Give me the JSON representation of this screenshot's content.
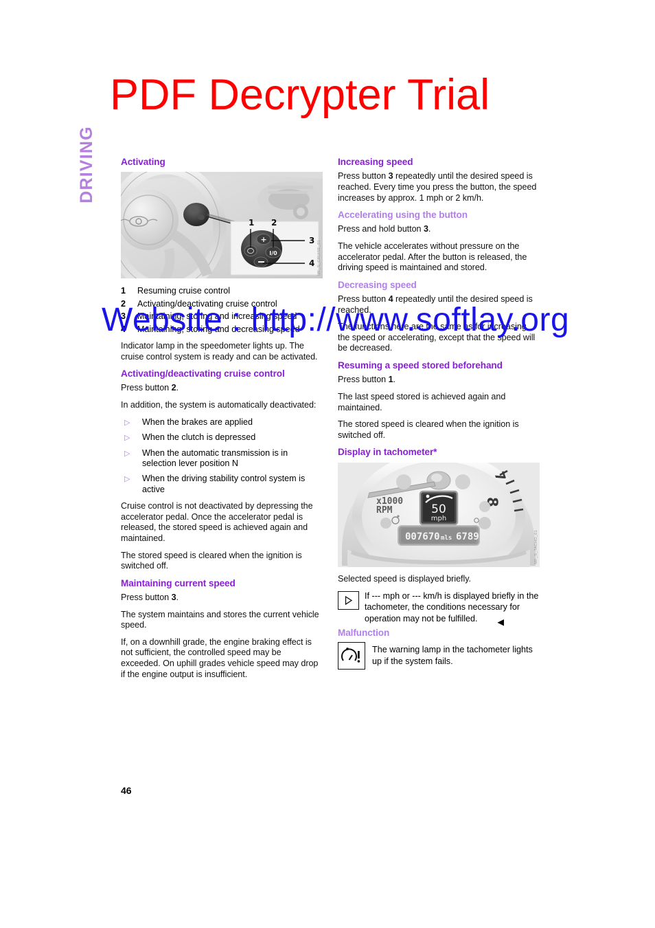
{
  "watermarks": {
    "title": "PDF Decrypter Trial",
    "title_color": "#ff0000",
    "url": "Website : http://www.softlay.org",
    "url_color": "#1a14e8"
  },
  "sidetab": {
    "label": "DRIVING",
    "color": "#b57fe0"
  },
  "page_number": "46",
  "colors": {
    "heading_primary": "#8a1fd6",
    "heading_secondary": "#b07fe8",
    "body": "#111111"
  },
  "left_column": {
    "activating": {
      "heading": "Activating",
      "figure": {
        "alt": "Steering wheel with cruise control button pod, callouts 1 to 4",
        "ref_code": "MF_S_CRUISE_01",
        "callouts": [
          "1",
          "2",
          "3",
          "4"
        ],
        "pod_labels": {
          "resume": "resume",
          "plus": "+",
          "onoff": "I/0",
          "minus": "−"
        }
      },
      "legend": [
        {
          "num": "1",
          "text": "Resuming cruise control"
        },
        {
          "num": "2",
          "text": "Activating/deactivating cruise control"
        },
        {
          "num": "3",
          "text": "Maintaining, storing and increasing speed"
        },
        {
          "num": "4",
          "text": "Maintaining, storing and decreasing speed"
        }
      ],
      "paragraph": "Indicator lamp in the speedometer lights up. The cruise control system is ready and can be activated."
    },
    "activating_deactivating": {
      "heading": "Activating/deactivating cruise control",
      "p1_pre": "Press button ",
      "p1_bold": "2",
      "p1_post": ".",
      "p2": "In addition, the system is automatically deactivated:",
      "bullets": [
        "When the brakes are applied",
        "When the clutch is depressed",
        "When the automatic transmission is in selection lever position N",
        "When the driving stability control system is active"
      ],
      "p3": "Cruise control is not deactivated by depressing the accelerator pedal. Once the accelerator pedal is released, the stored speed is achieved again and maintained.",
      "p4": "The stored speed is cleared when the ignition is switched off."
    },
    "maintaining_current_speed": {
      "heading": "Maintaining current speed",
      "p1_pre": "Press button ",
      "p1_bold": "3",
      "p1_post": ".",
      "p2": "The system maintains and stores the current vehicle speed.",
      "p3": "If, on a downhill grade, the engine braking effect is not sufficient, the controlled speed may be exceeded. On uphill grades vehicle speed may drop if the engine output is insufficient."
    }
  },
  "right_column": {
    "increasing_speed": {
      "heading": "Increasing speed",
      "p1_pre": "Press button ",
      "p1_bold": "3",
      "p1_post": " repeatedly until the desired speed is reached. Every time you press the button, the speed increases by  approx. 1 mph or 2 km/h."
    },
    "accelerating_using_button": {
      "heading": "Accelerating using the button",
      "p1_pre": "Press and hold button ",
      "p1_bold": "3",
      "p1_post": ".",
      "p2": "The vehicle accelerates without pressure on the accelerator pedal. After the button is released, the driving speed is maintained and stored."
    },
    "decreasing_speed": {
      "heading": "Decreasing speed",
      "p1_pre": "Press button ",
      "p1_bold": "4",
      "p1_post": " repeatedly until the desired speed is reached.",
      "p2": "The functions here are the same as for increasing the speed or accelerating, except that the speed will be decreased."
    },
    "resuming_stored_speed": {
      "heading": "Resuming a speed stored beforehand",
      "p1_pre": "Press button ",
      "p1_bold": "1",
      "p1_post": ".",
      "p2": "The last speed stored is achieved again and maintained.",
      "p3": "The stored speed is cleared when the ignition is switched off."
    },
    "display_in_tachometer": {
      "heading": "Display in tachometer*",
      "figure": {
        "alt": "Tachometer with cruise control speed display",
        "ref_code": "MF_S_TACHO_01",
        "rpm_label_line1": "x1000",
        "rpm_label_line2": "RPM",
        "speed_value": "50",
        "speed_unit": "mph",
        "odometer": "007670",
        "odometer_unit": "mls",
        "trip": "6789",
        "dial_marks": [
          "8"
        ]
      },
      "p1": "Selected speed is displayed briefly.",
      "note": "If  --- mph or --- km/h is displayed briefly in the tachometer, the conditions necessary for operation may not be fulfilled.",
      "note_end_marker": "◀"
    },
    "malfunction": {
      "heading": "Malfunction",
      "text": "The warning lamp in the tachometer lights up if the system fails."
    }
  }
}
